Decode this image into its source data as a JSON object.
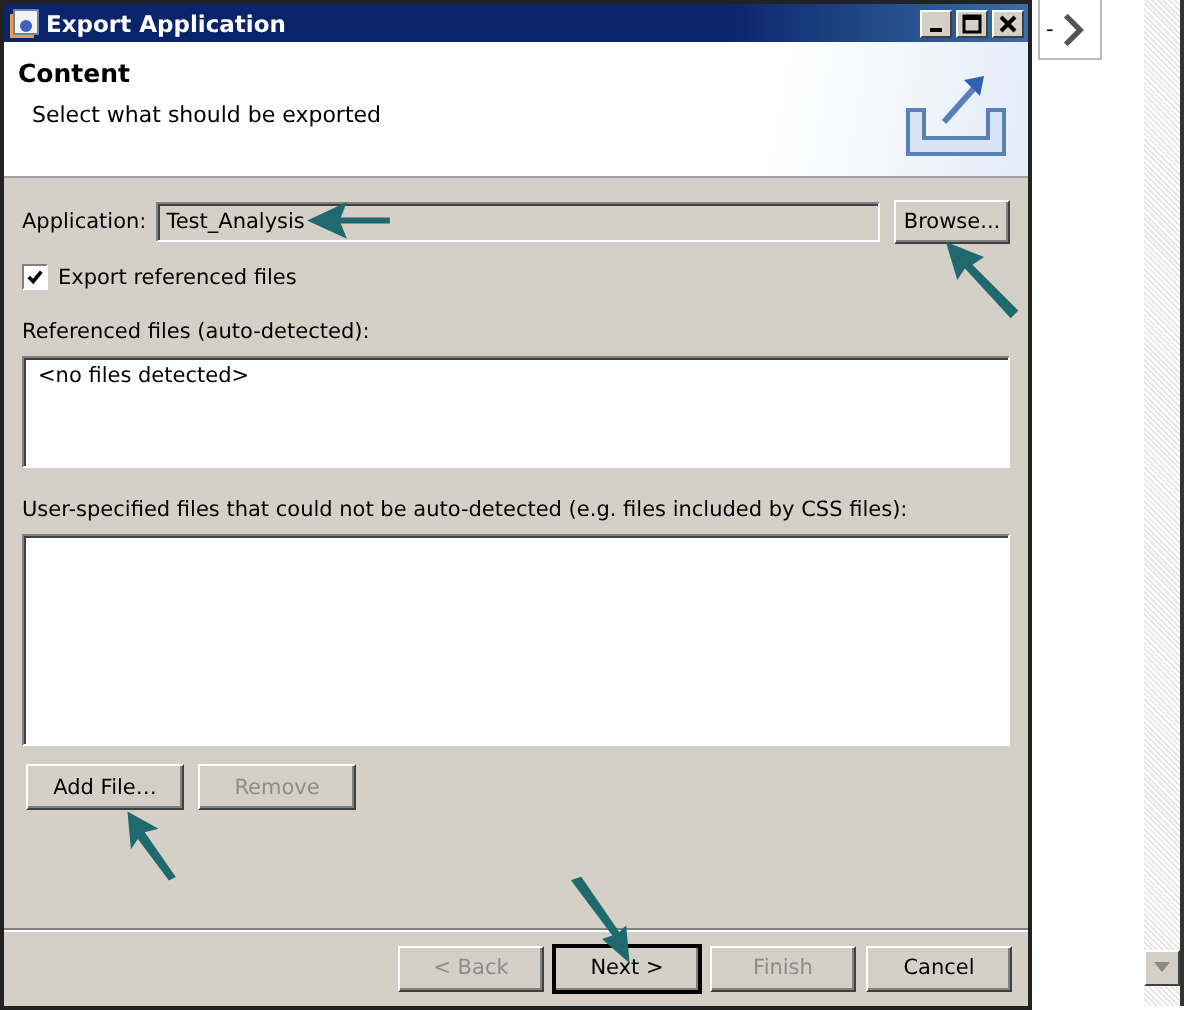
{
  "window": {
    "title": "Export Application"
  },
  "header": {
    "title": "Content",
    "subtitle": "Select what should be exported"
  },
  "application": {
    "label": "Application:",
    "value": "Test_Analysis",
    "browse": "Browse..."
  },
  "export_referenced": {
    "label": "Export referenced files",
    "checked": true
  },
  "referenced_files": {
    "label": "Referenced files (auto-detected):",
    "items": [
      "<no files detected>"
    ]
  },
  "user_files": {
    "label": "User-specified files that could not be auto-detected (e.g. files included by CSS files):"
  },
  "file_buttons": [
    {
      "label": "Add File…",
      "disabled": false
    },
    {
      "label": "Remove",
      "disabled": true
    }
  ],
  "wizard_buttons": [
    {
      "label": "< Back",
      "disabled": true,
      "default": false
    },
    {
      "label": "Next >",
      "disabled": false,
      "default": true
    },
    {
      "label": "Finish",
      "disabled": true,
      "default": false
    },
    {
      "label": "Cancel",
      "disabled": false,
      "default": false
    }
  ],
  "side_tab": {
    "label": "-"
  }
}
